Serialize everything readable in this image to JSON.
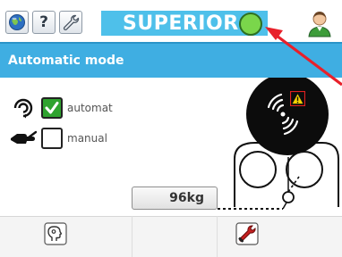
{
  "toolbar": {
    "home_icon": "home-globe-icon",
    "help_label": "?",
    "settings_icon": "wrench-icon"
  },
  "header": {
    "title": "SUPERIOR",
    "status_color": "#7ad64b",
    "user_icon": "user-avatar-icon"
  },
  "mode": {
    "title": "Automatic mode"
  },
  "options": [
    {
      "label": "automat",
      "checked": true,
      "icon": "auto-cycle-icon"
    },
    {
      "label": "manual",
      "checked": false,
      "icon": "manual-hand-icon"
    }
  ],
  "machine": {
    "weight": "96kg",
    "warning_icon": "warning-triangle-icon",
    "signal_icon": "wireless-signal-icon"
  },
  "bottom": {
    "left_icon": "operator-head-icon",
    "right_icon": "wrench-tool-icon"
  },
  "colors": {
    "accent": "#4ec0ea",
    "header": "#3faee2",
    "status": "#7ad64b",
    "annotation": "#e8202a"
  }
}
